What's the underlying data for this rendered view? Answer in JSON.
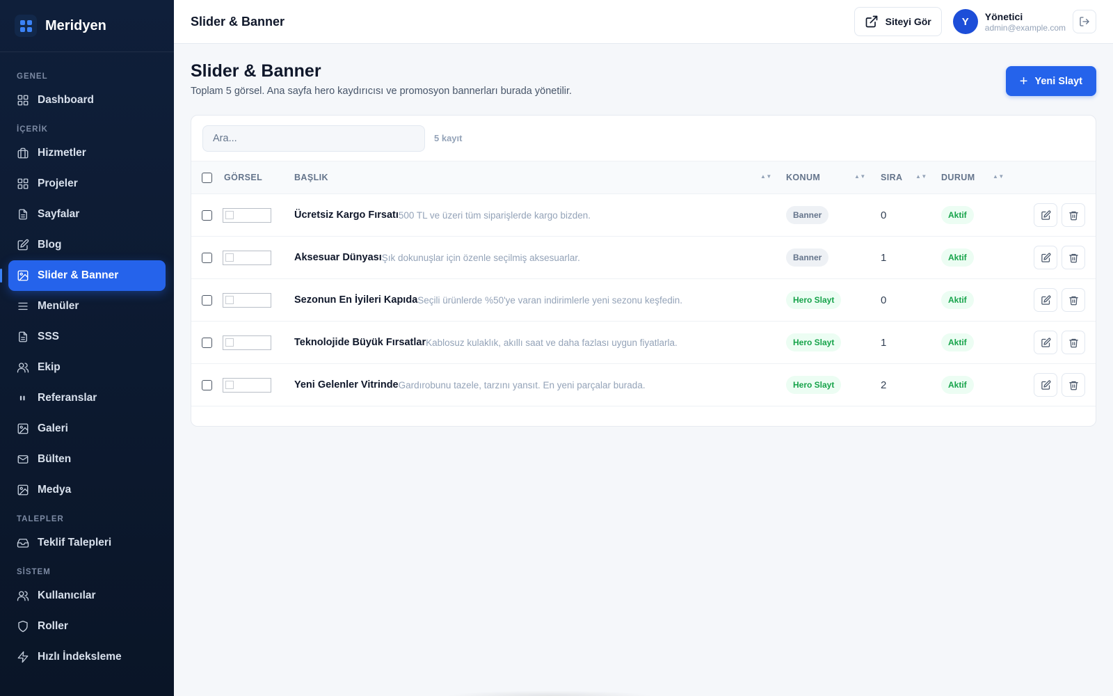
{
  "brand": {
    "name": "Meridyen",
    "icon": "grid-logo-icon"
  },
  "sidebar": {
    "sections": [
      {
        "label": "GENEL",
        "items": [
          {
            "label": "Dashboard",
            "icon": "dashboard-icon"
          }
        ]
      },
      {
        "label": "İÇERİK",
        "items": [
          {
            "label": "Hizmetler",
            "icon": "briefcase-icon"
          },
          {
            "label": "Projeler",
            "icon": "grid-icon"
          },
          {
            "label": "Sayfalar",
            "icon": "file-icon"
          },
          {
            "label": "Blog",
            "icon": "edit-icon"
          },
          {
            "label": "Slider & Banner",
            "icon": "image-icon",
            "active": true
          },
          {
            "label": "Menüler",
            "icon": "menu-icon"
          },
          {
            "label": "SSS",
            "icon": "file-icon"
          },
          {
            "label": "Ekip",
            "icon": "users-icon"
          },
          {
            "label": "Referanslar",
            "icon": "quote-icon"
          },
          {
            "label": "Galeri",
            "icon": "image-icon"
          },
          {
            "label": "Bülten",
            "icon": "mail-icon"
          },
          {
            "label": "Medya",
            "icon": "image-icon"
          }
        ]
      },
      {
        "label": "TALEPLER",
        "items": [
          {
            "label": "Teklif Talepleri",
            "icon": "inbox-icon"
          }
        ]
      },
      {
        "label": "SİSTEM",
        "items": [
          {
            "label": "Kullanıcılar",
            "icon": "users-icon"
          },
          {
            "label": "Roller",
            "icon": "shield-icon"
          },
          {
            "label": "Hızlı İndeksleme",
            "icon": "zap-icon"
          }
        ]
      }
    ]
  },
  "header": {
    "title": "Slider & Banner",
    "view_site": "Siteyi Gör",
    "user": {
      "initial": "Y",
      "name": "Yönetici",
      "email": "admin@example.com"
    }
  },
  "page": {
    "title": "Slider & Banner",
    "subtitle": "Toplam 5 görsel. Ana sayfa hero kaydırıcısı ve promosyon bannerları burada yönetilir.",
    "new_button": "Yeni Slayt"
  },
  "table": {
    "search_placeholder": "Ara...",
    "count": "5 kayıt",
    "columns": {
      "image": "GÖRSEL",
      "title": "BAŞLIK",
      "position": "KONUM",
      "order": "SIRA",
      "status": "DURUM"
    },
    "rows": [
      {
        "title": "Ücretsiz Kargo Fırsatı",
        "desc": "500 TL ve üzeri tüm siparişlerde kargo bizden.",
        "position": "Banner",
        "order": "0",
        "status": "Aktif"
      },
      {
        "title": "Aksesuar Dünyası",
        "desc": "Şık dokunuşlar için özenle seçilmiş aksesuarlar.",
        "position": "Banner",
        "order": "1",
        "status": "Aktif"
      },
      {
        "title": "Sezonun En İyileri Kapıda",
        "desc": "Seçili ürünlerde %50'ye varan indirimlerle yeni sezonu keşfedin.",
        "position": "Hero Slayt",
        "order": "0",
        "status": "Aktif"
      },
      {
        "title": "Teknolojide Büyük Fırsatlar",
        "desc": "Kablosuz kulaklık, akıllı saat ve daha fazlası uygun fiyatlarla.",
        "position": "Hero Slayt",
        "order": "1",
        "status": "Aktif"
      },
      {
        "title": "Yeni Gelenler Vitrinde",
        "desc": "Gardırobunu tazele, tarzını yansıt. En yeni parçalar burada.",
        "position": "Hero Slayt",
        "order": "2",
        "status": "Aktif"
      }
    ]
  },
  "colors": {
    "accent": "#2563eb",
    "sidebar_bg": "#0f1f3a",
    "success": "#16a34a"
  }
}
